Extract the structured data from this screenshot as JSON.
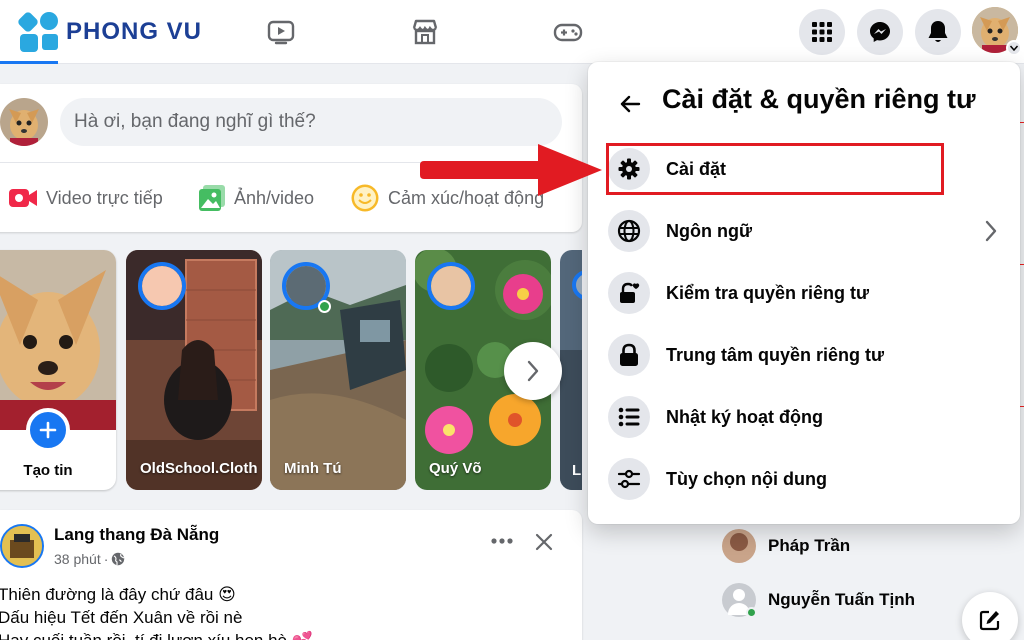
{
  "brand": {
    "name": "PHONG VU",
    "color": "#1c3f95",
    "accent": "#2aa8e0"
  },
  "topbar": {
    "nav_icons": [
      "watch-icon",
      "marketplace-icon",
      "gaming-icon"
    ],
    "right_buttons": [
      "menu-grid-icon",
      "messenger-icon",
      "bell-icon"
    ]
  },
  "composer": {
    "placeholder": "Hà ơi, bạn đang nghĩ gì thế?",
    "actions": [
      {
        "label": "Video trực tiếp",
        "icon": "live-video-icon",
        "color": "#f02849"
      },
      {
        "label": "Ảnh/video",
        "icon": "photo-icon",
        "color": "#45bd62"
      },
      {
        "label": "Cảm xúc/hoạt động",
        "icon": "feeling-icon",
        "color": "#f7b928"
      }
    ]
  },
  "stories": [
    {
      "name": "Tạo tin"
    },
    {
      "name": "OldSchool.Cloth"
    },
    {
      "name": "Minh Tú"
    },
    {
      "name": "Quý Võ"
    },
    {
      "name": "L"
    }
  ],
  "post": {
    "author": "Lang thang Đà Nẵng",
    "time": "38 phút",
    "lines": [
      "Thiên đường là đây chứ đâu 😍",
      "Dấu hiệu Tết đến Xuân về rồi nè",
      "Hay cuối tuần rồi, tí đi lượn xíu hẹn hò 💕"
    ]
  },
  "contacts": [
    {
      "name": "Pháp Trần"
    },
    {
      "name": "Nguyễn Tuấn Tịnh"
    }
  ],
  "menu": {
    "title": "Cài đặt & quyền riêng tư",
    "items": [
      {
        "label": "Cài đặt",
        "icon": "gear-icon",
        "highlighted": true
      },
      {
        "label": "Ngôn ngữ",
        "icon": "globe-icon",
        "has_submenu": true
      },
      {
        "label": "Kiểm tra quyền riêng tư",
        "icon": "lock-heart-icon"
      },
      {
        "label": "Trung tâm quyền riêng tư",
        "icon": "lock-icon"
      },
      {
        "label": "Nhật ký hoạt động",
        "icon": "list-icon"
      },
      {
        "label": "Tùy chọn nội dung",
        "icon": "sliders-icon"
      }
    ]
  },
  "colors": {
    "facebook_blue": "#1877f2",
    "annotation_red": "#e11b22",
    "background": "#f0f2f5"
  }
}
